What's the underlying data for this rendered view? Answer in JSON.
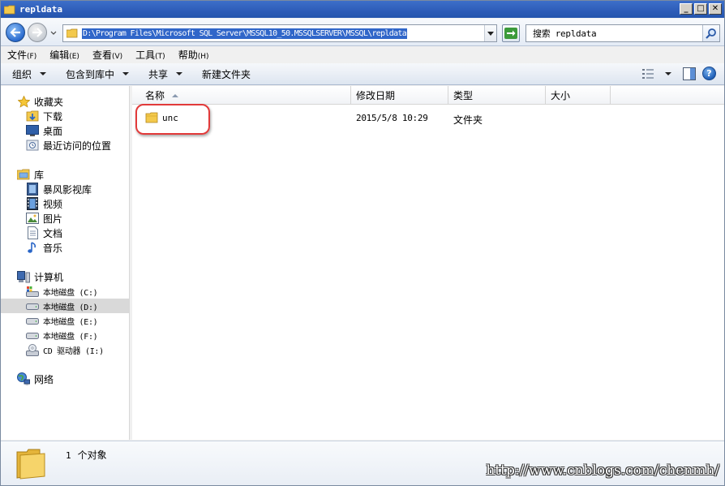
{
  "window": {
    "title": "repldata",
    "minimize_label": "_",
    "maximize_label": "□",
    "close_label": "✕"
  },
  "address_bar": {
    "path": "D:\\Program Files\\Microsoft SQL Server\\MSSQL10_50.MSSQLSERVER\\MSSQL\\repldata",
    "search_text": "搜索 repldata"
  },
  "menubar": {
    "items": [
      {
        "label": "文件",
        "key": "(F)"
      },
      {
        "label": "编辑",
        "key": "(E)"
      },
      {
        "label": "查看",
        "key": "(V)"
      },
      {
        "label": "工具",
        "key": "(T)"
      },
      {
        "label": "帮助",
        "key": "(H)"
      }
    ]
  },
  "toolbar": {
    "organize": "组织",
    "include_library": "包含到库中",
    "share": "共享",
    "new_folder": "新建文件夹"
  },
  "nav": {
    "favorites": "收藏夹",
    "downloads": "下载",
    "desktop": "桌面",
    "recent": "最近访问的位置",
    "libraries": "库",
    "storm": "暴风影视库",
    "videos": "视频",
    "pictures": "图片",
    "documents": "文档",
    "music": "音乐",
    "computer": "计算机",
    "drive_c": "本地磁盘 (C:)",
    "drive_d": "本地磁盘 (D:)",
    "drive_e": "本地磁盘 (E:)",
    "drive_f": "本地磁盘 (F:)",
    "cd_drive": "CD 驱动器 (I:)",
    "network": "网络"
  },
  "columns": {
    "name": "名称",
    "modified": "修改日期",
    "type": "类型",
    "size": "大小"
  },
  "files": [
    {
      "name": "unc",
      "modified": "2015/5/8 10:29",
      "type": "文件夹",
      "size": ""
    }
  ],
  "details": {
    "count": "1",
    "label": "个对象"
  },
  "watermark": "http://www.cnblogs.com/chenmh/",
  "colors": {
    "highlight_ring": "#e23a3a",
    "selection": "#3066c9",
    "titlebar": "#2d5cb8"
  }
}
